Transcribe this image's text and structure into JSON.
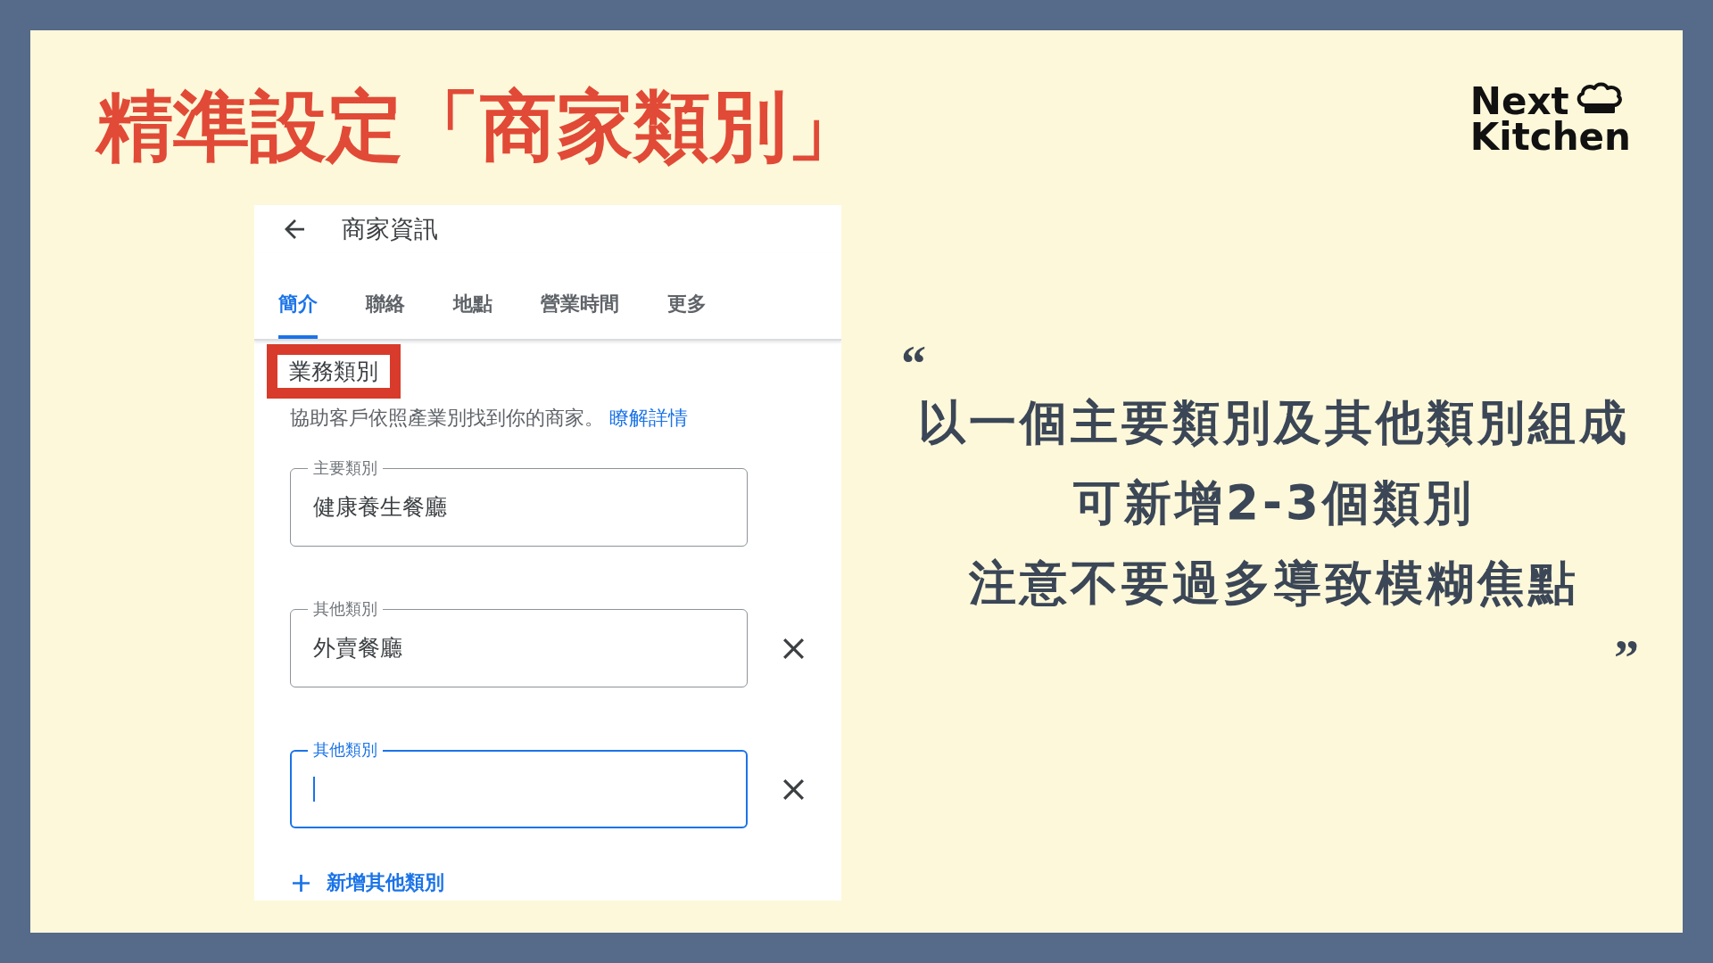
{
  "slide": {
    "title": "精準設定「商家類別」",
    "logo": {
      "line_1": "Next",
      "line_2": "Kitchen"
    }
  },
  "screenshot": {
    "header": {
      "title": "商家資訊"
    },
    "tabs": [
      {
        "label": "簡介",
        "selected": true
      },
      {
        "label": "聯絡",
        "selected": false
      },
      {
        "label": "地點",
        "selected": false
      },
      {
        "label": "營業時間",
        "selected": false
      },
      {
        "label": "更多",
        "selected": false
      }
    ],
    "section": {
      "heading": "業務類別",
      "highlighted": true,
      "description": "協助客戶依照產業別找到你的商家。",
      "link": "瞭解詳情"
    },
    "fields": [
      {
        "label": "主要類別",
        "value": "健康養生餐廳",
        "focused": false,
        "removable": false
      },
      {
        "label": "其他類別",
        "value": "外賣餐廳",
        "focused": false,
        "removable": true
      },
      {
        "label": "其他類別",
        "focused": true,
        "removable": true
      }
    ],
    "add_button": {
      "label": "新增其他類別"
    }
  },
  "quote": {
    "open_mark": "“",
    "lines": [
      "以一個主要類別及其他類別組成",
      "可新增2-3個類別",
      "注意不要過多導致模糊焦點"
    ],
    "close_mark": "”"
  }
}
